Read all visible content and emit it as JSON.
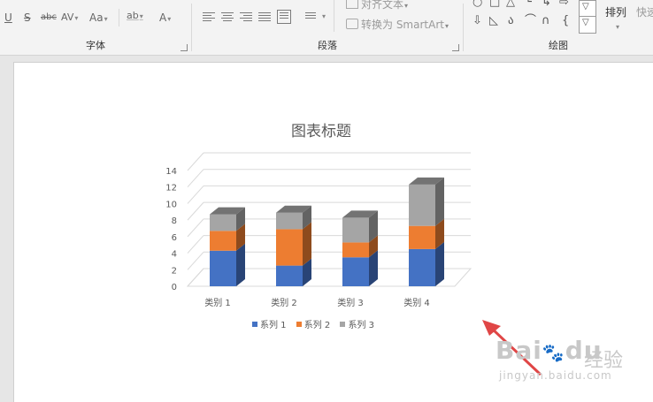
{
  "ribbon": {
    "font_group": {
      "label": "字体",
      "underline": "U",
      "strikethrough": "S",
      "abc": "abc",
      "spacing": "AV",
      "change_case": "Aa",
      "highlight": "ab",
      "font_color": "A"
    },
    "paragraph_group": {
      "label": "段落",
      "align_text": "对齐文本",
      "convert_smartart": "转换为 SmartArt"
    },
    "drawing_group": {
      "label": "绘图",
      "arrange": "排列",
      "quick_styles": "快速"
    }
  },
  "chart_data": {
    "type": "bar",
    "stacked": true,
    "three_d": true,
    "title": "图表标题",
    "categories": [
      "类别 1",
      "类别 2",
      "类别 3",
      "类别 4"
    ],
    "series": [
      {
        "name": "系列 1",
        "values": [
          4.3,
          2.5,
          3.5,
          4.5
        ],
        "color": "#4472c4"
      },
      {
        "name": "系列 2",
        "values": [
          2.4,
          4.4,
          1.8,
          2.8
        ],
        "color": "#ed7d31"
      },
      {
        "name": "系列 3",
        "values": [
          2.0,
          2.0,
          3.0,
          5.0
        ],
        "color": "#a5a5a5"
      }
    ],
    "yticks": [
      "0",
      "2",
      "4",
      "6",
      "8",
      "10",
      "12",
      "14"
    ],
    "ylim": [
      0,
      14
    ],
    "grid": true,
    "legend_position": "bottom"
  },
  "colors": {
    "arrow": "#e04646",
    "ribbon_bg": "#f3f3f3",
    "canvas_bg": "#e6e6e6"
  },
  "watermark": {
    "brand": "Bai",
    "brand2": "du",
    "cn": "经验",
    "url": "jingyan.baidu.com"
  }
}
